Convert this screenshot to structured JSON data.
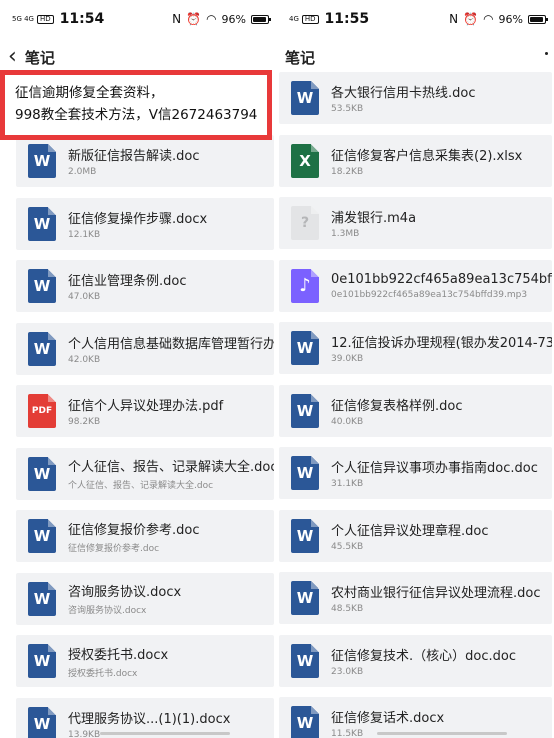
{
  "left_panel": {
    "status": {
      "time": "11:54",
      "signal": "5G 4G",
      "battery": "96%"
    },
    "title": "笔记",
    "banner": {
      "line1": "征信逾期修复全套资料，",
      "line2": "998教全套技术方法，V信2672463794"
    },
    "files": [
      {
        "name": "新版征信报告解读.doc",
        "sub": "2.0MB",
        "icon": "word-icon",
        "glyph": "W"
      },
      {
        "name": "征信修复操作步骤.docx",
        "sub": "12.1KB",
        "icon": "word-icon",
        "glyph": "W"
      },
      {
        "name": "征信业管理条例.doc",
        "sub": "47.0KB",
        "icon": "word-icon",
        "glyph": "W"
      },
      {
        "name": "个人信用信息基础数据库管理暂行办",
        "sub": "42.0KB",
        "icon": "word-icon",
        "glyph": "W"
      },
      {
        "name": "征信个人异议处理办法.pdf",
        "sub": "98.2KB",
        "icon": "pdf-icon",
        "glyph": "PDF"
      },
      {
        "name": "个人征信、报告、记录解读大全.doc",
        "sub": "个人征信、报告、记录解读大全.doc",
        "icon": "word-icon",
        "glyph": "W"
      },
      {
        "name": "征信修复报价参考.doc",
        "sub": "征信修复报价参考.doc",
        "icon": "word-icon",
        "glyph": "W"
      },
      {
        "name": "咨询服务协议.docx",
        "sub": "咨询服务协议.docx",
        "icon": "word-icon",
        "glyph": "W"
      },
      {
        "name": "授权委托书.docx",
        "sub": "授权委托书.docx",
        "icon": "word-icon",
        "glyph": "W"
      },
      {
        "name": "代理服务协议...(1)(1).docx",
        "sub": "13.9KB",
        "icon": "word-icon",
        "glyph": "W"
      }
    ]
  },
  "right_panel": {
    "status": {
      "time": "11:55",
      "signal": "4G",
      "battery": "96%"
    },
    "title": "笔记",
    "files": [
      {
        "name": "各大银行信用卡热线.doc",
        "sub": "53.5KB",
        "icon": "word-icon",
        "glyph": "W"
      },
      {
        "name": "征信修复客户信息采集表(2).xlsx",
        "sub": "18.2KB",
        "icon": "excel-icon",
        "glyph": "X"
      },
      {
        "name": "浦发银行.m4a",
        "sub": "1.3MB",
        "icon": "unknown-file-icon",
        "glyph": "?"
      },
      {
        "name": "0e101bb922cf465a89ea13c754bffd39.",
        "sub": "0e101bb922cf465a89ea13c754bffd39.mp3",
        "icon": "music-icon",
        "glyph": "♪"
      },
      {
        "name": "12.征信投诉办理规程(银办发2014-73)...",
        "sub": "39.0KB",
        "icon": "word-icon",
        "glyph": "W"
      },
      {
        "name": "征信修复表格样例.doc",
        "sub": "40.0KB",
        "icon": "word-icon",
        "glyph": "W"
      },
      {
        "name": "个人征信异议事项办事指南doc.doc",
        "sub": "31.1KB",
        "icon": "word-icon",
        "glyph": "W"
      },
      {
        "name": "个人征信异议处理章程.doc",
        "sub": "45.5KB",
        "icon": "word-icon",
        "glyph": "W"
      },
      {
        "name": "农村商业银行征信异议处理流程.doc",
        "sub": "48.5KB",
        "icon": "word-icon",
        "glyph": "W"
      },
      {
        "name": "征信修复技术.（核心）doc.doc",
        "sub": "23.0KB",
        "icon": "word-icon",
        "glyph": "W"
      },
      {
        "name": "征信修复话术.docx",
        "sub": "11.5KB",
        "icon": "word-icon",
        "glyph": "W"
      }
    ]
  },
  "colors": {
    "word": "#2b5797",
    "excel": "#1e7145",
    "pdf": "#e33d36",
    "audio": "#7b61ff",
    "banner_border": "#e8393a",
    "item_bg": "#f1f2f4"
  }
}
